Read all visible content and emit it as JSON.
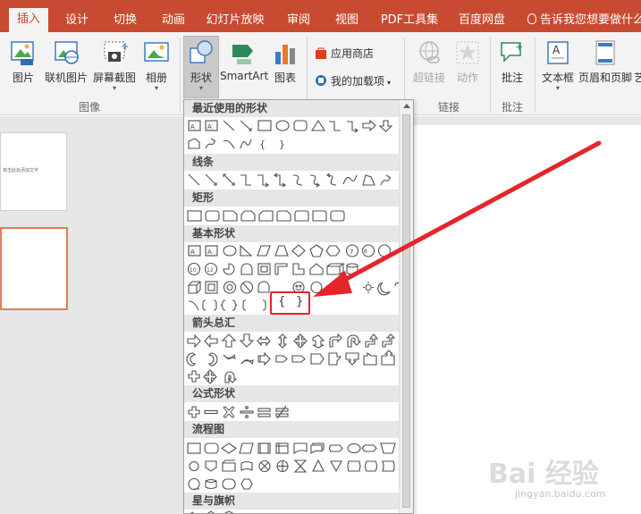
{
  "tabs": [
    "插入",
    "设计",
    "切换",
    "动画",
    "幻灯片放映",
    "审阅",
    "视图",
    "PDF工具集",
    "百度网盘"
  ],
  "tell_me": "告诉我您想要做什么",
  "ribbon": {
    "picture": "图片",
    "online_picture": "联机图片",
    "screenshot": "屏幕截图",
    "album": "相册",
    "shapes": "形状",
    "smartart": "SmartArt",
    "chart": "图表",
    "store": "应用商店",
    "my_addins": "我的加载项",
    "hyperlink": "超链接",
    "action": "动作",
    "comment": "批注",
    "textbox": "文本框",
    "header_footer": "页眉和页脚",
    "wordart": "艺",
    "group_images": "图像",
    "group_links": "链接",
    "group_comments": "批注"
  },
  "thumb_text": "单击此处添加文字",
  "dropdown": {
    "categories": [
      "最近使用的形状",
      "线条",
      "矩形",
      "基本形状",
      "箭头总汇",
      "公式形状",
      "流程图",
      "星与旗帜"
    ]
  },
  "brace_symbols": {
    "left": "{",
    "right": "}"
  },
  "colors": {
    "accent": "#c84b31",
    "highlight": "#e4252c"
  },
  "watermark": {
    "brand": "Bai 经验",
    "url": "jingyan.baidu.com"
  }
}
